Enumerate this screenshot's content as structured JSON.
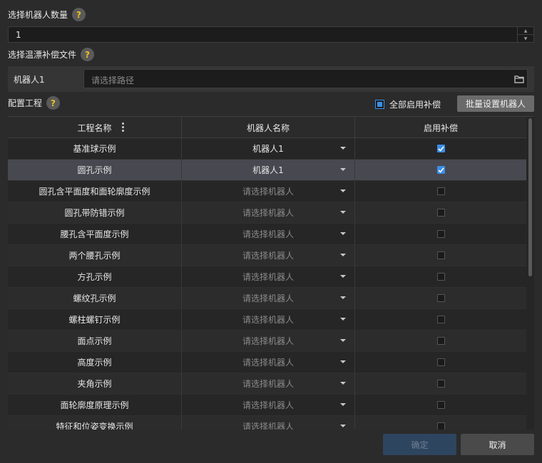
{
  "robot_count": {
    "label": "选择机器人数量",
    "value": "1"
  },
  "temp_drift": {
    "label": "选择温漂补偿文件",
    "robot_label": "机器人1",
    "path_placeholder": "请选择路径"
  },
  "config": {
    "label": "配置工程",
    "enable_all_label": "全部启用补偿",
    "enable_all_state": "partial",
    "batch_button": "批量设置机器人"
  },
  "table": {
    "headers": [
      "工程名称",
      "机器人名称",
      "启用补偿"
    ],
    "robot_placeholder": "请选择机器人",
    "selected_row_index": 1,
    "rows": [
      {
        "project": "基准球示例",
        "robot": "机器人1",
        "enabled": true
      },
      {
        "project": "圆孔示例",
        "robot": "机器人1",
        "enabled": true
      },
      {
        "project": "圆孔含平面度和面轮廓度示例",
        "robot": "",
        "enabled": false
      },
      {
        "project": "圆孔带防错示例",
        "robot": "",
        "enabled": false
      },
      {
        "project": "腰孔含平面度示例",
        "robot": "",
        "enabled": false
      },
      {
        "project": "两个腰孔示例",
        "robot": "",
        "enabled": false
      },
      {
        "project": "方孔示例",
        "robot": "",
        "enabled": false
      },
      {
        "project": "螺纹孔示例",
        "robot": "",
        "enabled": false
      },
      {
        "project": "螺柱螺钉示例",
        "robot": "",
        "enabled": false
      },
      {
        "project": "面点示例",
        "robot": "",
        "enabled": false
      },
      {
        "project": "高度示例",
        "robot": "",
        "enabled": false
      },
      {
        "project": "夹角示例",
        "robot": "",
        "enabled": false
      },
      {
        "project": "面轮廓度原理示例",
        "robot": "",
        "enabled": false
      },
      {
        "project": "特征和位姿变换示例",
        "robot": "",
        "enabled": false
      }
    ]
  },
  "footer": {
    "ok_label": "确定",
    "cancel_label": "取消"
  },
  "colors": {
    "accent": "#3a8ee6",
    "background": "#2b2b2b",
    "selected_row": "#484850"
  }
}
